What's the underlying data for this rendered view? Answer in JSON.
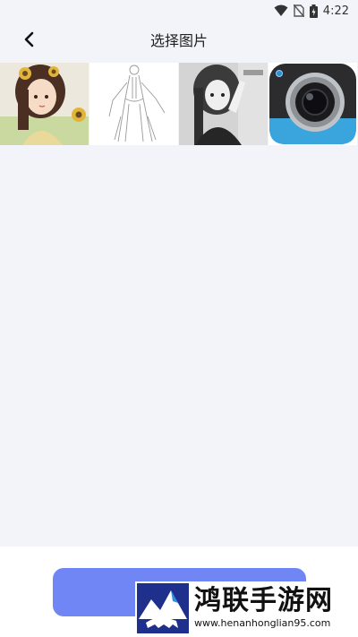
{
  "status_bar": {
    "time": "4:22",
    "icons": [
      "wifi-icon",
      "no-sim-icon",
      "battery-charging-icon"
    ]
  },
  "header": {
    "back_icon": "chevron-left-icon",
    "title": "选择图片"
  },
  "gallery": {
    "items": [
      {
        "name": "thumbnail-girl-sunflower",
        "kind": "photo"
      },
      {
        "name": "thumbnail-line-sketch",
        "kind": "photo"
      },
      {
        "name": "thumbnail-grayscale-girl",
        "kind": "photo"
      },
      {
        "name": "thumbnail-camera-app-icon",
        "kind": "icon"
      }
    ]
  },
  "bottom": {
    "button_color": "#6f86f4"
  },
  "watermark": {
    "title": "鸿联手游网",
    "url": "www.henanhonglian95.com"
  },
  "colors": {
    "background": "#f3f3fa",
    "accent": "#6f86f4"
  }
}
